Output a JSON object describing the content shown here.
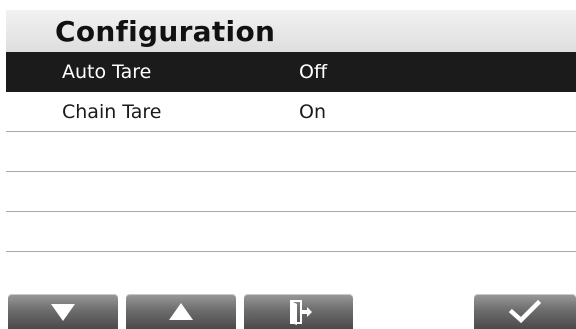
{
  "header": {
    "title": "Configuration"
  },
  "settings": [
    {
      "label": "Auto Tare",
      "value": "Off",
      "selected": true
    },
    {
      "label": "Chain Tare",
      "value": "On",
      "selected": false
    }
  ],
  "empty_row_count": 4,
  "toolbar": {
    "buttons": [
      {
        "name": "down-button",
        "icon": "arrow-down-icon"
      },
      {
        "name": "up-button",
        "icon": "arrow-up-icon"
      },
      {
        "name": "exit-button",
        "icon": "exit-door-icon"
      },
      {
        "name": "confirm-button",
        "icon": "checkmark-icon"
      }
    ]
  },
  "colors": {
    "selected_row": "#1b1b1b",
    "button_top": "#9a9a9a",
    "button_bottom": "#4a4a4a",
    "divider": "#a9a9a9"
  }
}
